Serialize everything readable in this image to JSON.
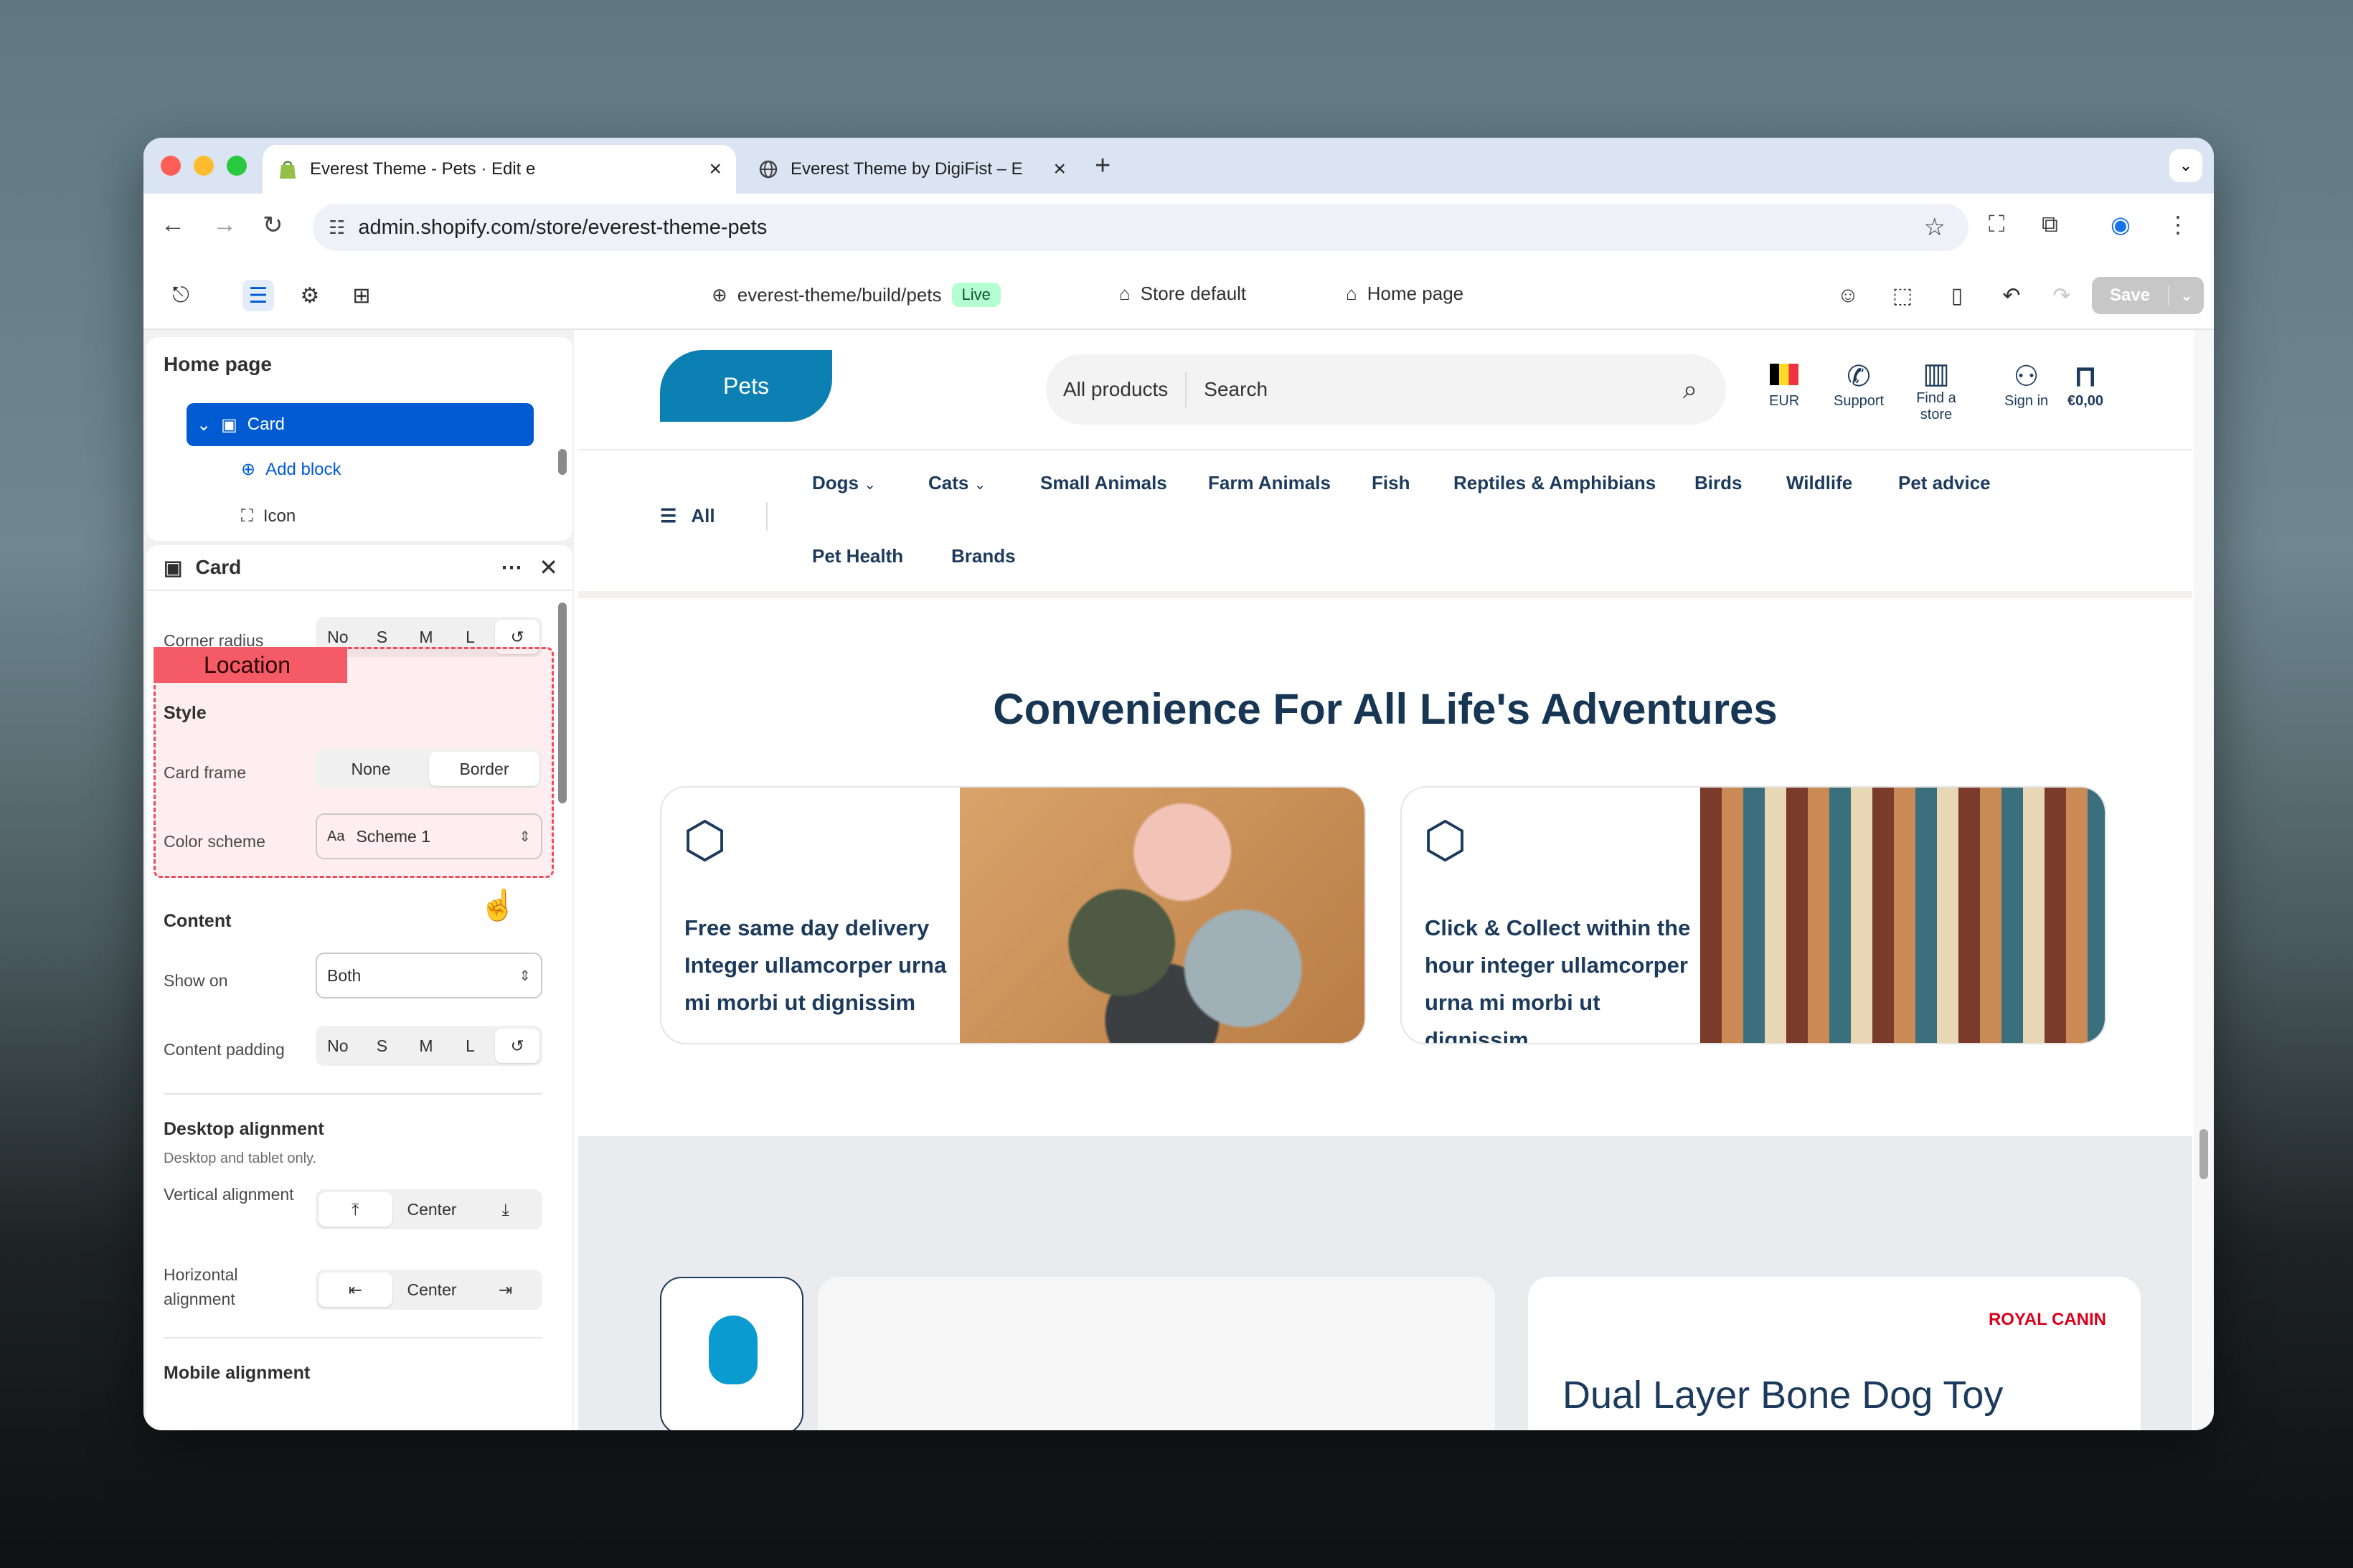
{
  "browser": {
    "tabs": [
      {
        "title": "Everest Theme - Pets · Edit e"
      },
      {
        "title": "Everest Theme by DigiFist – E"
      }
    ],
    "url": "admin.shopify.com/store/everest-theme-pets"
  },
  "toolbar": {
    "theme_path": "everest-theme/build/pets",
    "live_badge": "Live",
    "store_default": "Store default",
    "page": "Home page",
    "save_label": "Save"
  },
  "structure_panel": {
    "title": "Home page",
    "selected": "Card",
    "add_block": "Add block",
    "icon_item": "Icon"
  },
  "settings_panel": {
    "title": "Card",
    "corner_radius_label": "Corner radius",
    "size_options": [
      "No",
      "S",
      "M",
      "L"
    ],
    "location_annotation": "Location",
    "style_heading": "Style",
    "card_frame_label": "Card frame",
    "card_frame_options": [
      "None",
      "Border"
    ],
    "card_frame_selected": "Border",
    "color_scheme_label": "Color scheme",
    "color_scheme_value": "Scheme 1",
    "color_scheme_icon_text": "Aa",
    "content_heading": "Content",
    "show_on_label": "Show on",
    "show_on_value": "Both",
    "content_padding_label": "Content padding",
    "desktop_alignment_heading": "Desktop alignment",
    "desktop_alignment_note": "Desktop and tablet only.",
    "vertical_alignment_label": "Vertical alignment",
    "vertical_alignment_value": "Center",
    "horizontal_alignment_label": "Horizontal alignment",
    "horizontal_alignment_value": "Center",
    "mobile_alignment_heading": "Mobile alignment"
  },
  "storefront": {
    "logo": "Pets",
    "search_category": "All products",
    "search_placeholder": "Search",
    "currency": "EUR",
    "support": "Support",
    "find_store": "Find a store",
    "sign_in": "Sign in",
    "cart_total": "€0,00",
    "nav_all": "All",
    "nav_links": [
      "Dogs",
      "Cats",
      "Small Animals",
      "Farm Animals",
      "Fish",
      "Reptiles & Amphibians",
      "Birds",
      "Wildlife",
      "Pet advice",
      "Pet Health",
      "Brands"
    ],
    "headline": "Convenience For All Life's Adventures",
    "cards": [
      {
        "text": "Free same day delivery Integer ullamcorper urna mi morbi ut dignissim"
      },
      {
        "text": "Click & Collect within the hour integer ullamcorper urna mi morbi ut dignissim"
      }
    ],
    "product_brand": "ROYAL CANIN",
    "product_title": "Dual Layer Bone Dog Toy"
  }
}
